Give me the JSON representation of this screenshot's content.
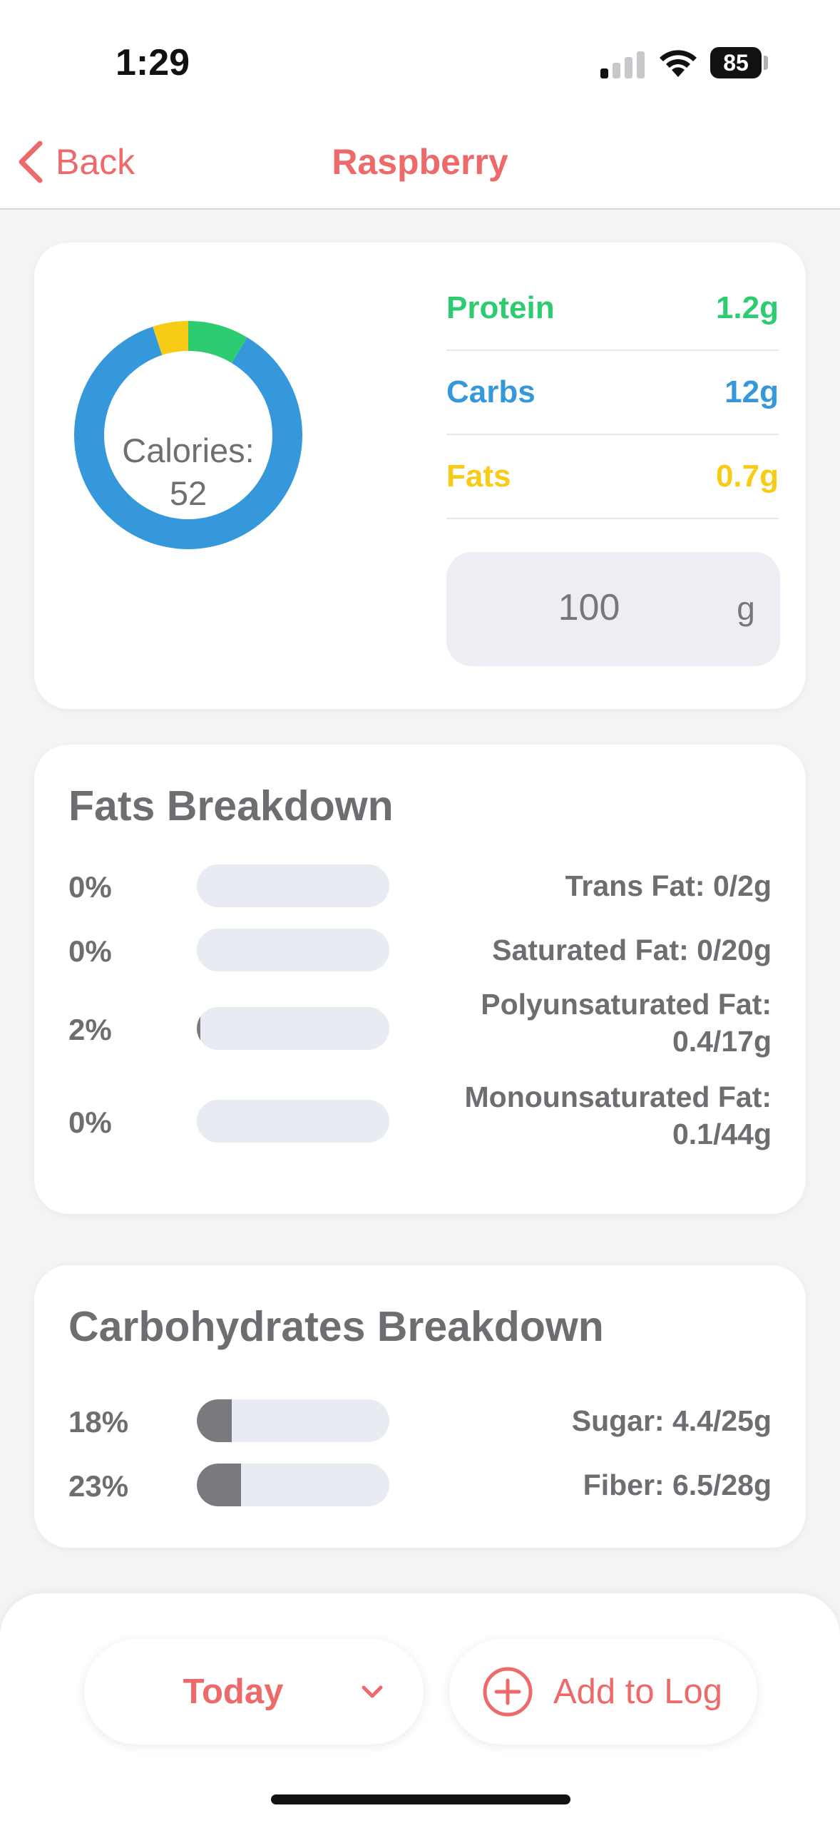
{
  "status_bar": {
    "time": "1:29",
    "battery": "85",
    "icons": [
      "cellular-signal-icon",
      "wifi-icon",
      "battery-icon"
    ]
  },
  "nav": {
    "back_label": "Back",
    "title": "Raspberry"
  },
  "summary": {
    "calories_label": "Calories:",
    "calories_value": "52",
    "macros": [
      {
        "name": "Protein",
        "value": "1.2g",
        "color": "#2ecc71"
      },
      {
        "name": "Carbs",
        "value": "12g",
        "color": "#3498db"
      },
      {
        "name": "Fats",
        "value": "0.7g",
        "color": "#f7cb16"
      }
    ],
    "serving_amount": "100",
    "serving_unit": "g"
  },
  "fats": {
    "title": "Fats Breakdown",
    "rows": [
      {
        "percent": "0%",
        "fraction": 0.0,
        "label": "Trans Fat: 0/2g"
      },
      {
        "percent": "0%",
        "fraction": 0.0,
        "label": "Saturated Fat: 0/20g"
      },
      {
        "percent": "2%",
        "fraction": 0.02,
        "label": "Polyunsaturated Fat: 0.4/17g"
      },
      {
        "percent": "0%",
        "fraction": 0.0,
        "label": "Monounsaturated Fat: 0.1/44g"
      }
    ]
  },
  "carbs": {
    "title": "Carbohydrates Breakdown",
    "rows": [
      {
        "percent": "18%",
        "fraction": 0.18,
        "label": "Sugar: 4.4/25g"
      },
      {
        "percent": "23%",
        "fraction": 0.23,
        "label": "Fiber: 6.5/28g"
      }
    ]
  },
  "footer": {
    "day_label": "Today",
    "add_label": "Add to Log"
  },
  "colors": {
    "accent": "#ee6a6a",
    "protein": "#2ecc71",
    "carbs": "#3498db",
    "fats": "#f7cb16",
    "bar_fill": "#7a7a7e",
    "bar_track": "#e9ebf3"
  },
  "chart_data": {
    "type": "pie",
    "categories": [
      "Protein",
      "Carbs",
      "Fats"
    ],
    "values": [
      1.2,
      12,
      0.7
    ]
  }
}
